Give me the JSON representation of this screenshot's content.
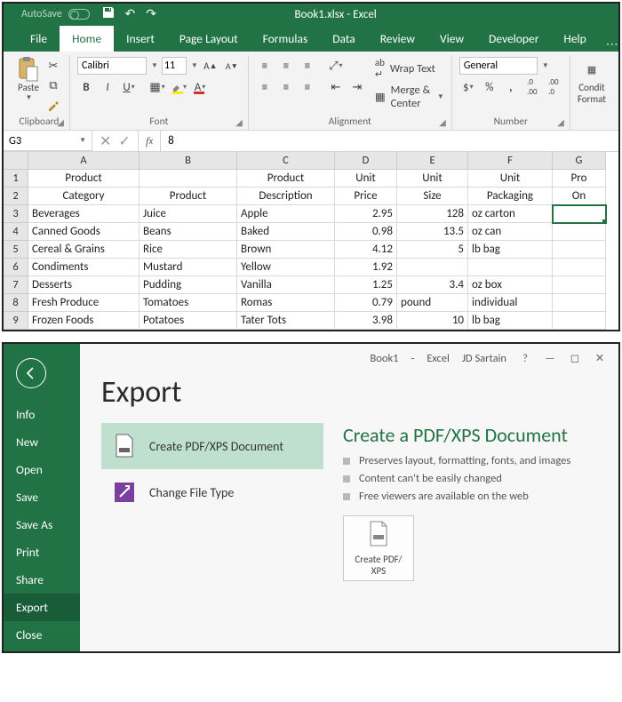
{
  "titlebar": {
    "autosave": "AutoSave",
    "doc_title": "Book1.xlsx - Excel"
  },
  "tabs": [
    "File",
    "Home",
    "Insert",
    "Page Layout",
    "Formulas",
    "Data",
    "Review",
    "View",
    "Developer",
    "Help"
  ],
  "active_tab": "Home",
  "ribbon": {
    "clipboard": {
      "paste": "Paste",
      "label": "Clipboard"
    },
    "font": {
      "name": "Calibri",
      "size": "11",
      "label": "Font"
    },
    "alignment": {
      "wrap": "Wrap Text",
      "merge": "Merge & Center",
      "label": "Alignment"
    },
    "number": {
      "format": "General",
      "label": "Number"
    },
    "styles": {
      "cond1": "Condit",
      "cond2": "Format"
    }
  },
  "namebox": "G3",
  "formula_value": "8",
  "columns": [
    "A",
    "B",
    "C",
    "D",
    "E",
    "F",
    "G"
  ],
  "col_widths": [
    "wA",
    "wB",
    "wC",
    "wD",
    "wE",
    "wF",
    "wG"
  ],
  "row_nums": [
    1,
    2,
    3,
    4,
    5,
    6,
    7,
    8,
    9
  ],
  "header_row1": [
    "Product",
    "",
    "Product",
    "Unit",
    "Unit",
    "Unit",
    "Pro"
  ],
  "header_row2": [
    "Category",
    "Product",
    "Description",
    "Price",
    "Size",
    "Packaging",
    "On"
  ],
  "rows": [
    [
      "Beverages",
      "Juice",
      "Apple",
      "2.95",
      "128",
      "oz carton",
      ""
    ],
    [
      "Canned Goods",
      "Beans",
      "Baked",
      "0.98",
      "13.5",
      "oz can",
      ""
    ],
    [
      "Cereal & Grains",
      "Rice",
      "Brown",
      "4.12",
      "5",
      "lb bag",
      ""
    ],
    [
      "Condiments",
      "Mustard",
      "Yellow",
      "1.92",
      "",
      "",
      ""
    ],
    [
      "Desserts",
      "Pudding",
      "Vanilla",
      "1.25",
      "3.4",
      "oz box",
      ""
    ],
    [
      "Fresh Produce",
      "Tomatoes",
      "Romas",
      "0.79",
      "pound",
      "individual",
      ""
    ],
    [
      "Frozen Foods",
      "Potatoes",
      "Tater Tots",
      "3.98",
      "10",
      "lb bag",
      ""
    ]
  ],
  "right_align_cols": [
    3,
    4
  ],
  "selected_cell": {
    "row": 3,
    "col": 6
  },
  "backstage": {
    "title_parts": {
      "book": "Book1",
      "dash": "-",
      "app": "Excel",
      "user": "JD Sartain"
    },
    "nav": [
      "Info",
      "New",
      "Open",
      "Save",
      "Save As",
      "Print",
      "Share",
      "Export",
      "Close"
    ],
    "active_nav": "Export",
    "heading": "Export",
    "options": [
      {
        "label": "Create PDF/XPS Document",
        "selected": true
      },
      {
        "label": "Change File Type",
        "selected": false
      }
    ],
    "right": {
      "heading": "Create a PDF/XPS Document",
      "bullets": [
        "Preserves layout, formatting, fonts, and images",
        "Content can't be easily changed",
        "Free viewers are available on the web"
      ],
      "button": "Create PDF/\nXPS"
    }
  }
}
